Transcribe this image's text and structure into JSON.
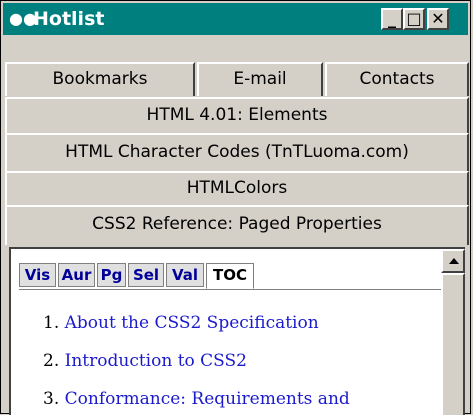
{
  "window": {
    "title": "Hotlist",
    "icon": "glasses-icon"
  },
  "title_buttons": {
    "minimize": "_",
    "maximize": "□",
    "close": "✕"
  },
  "tabs_row1": [
    "Bookmarks",
    "E-mail",
    "Contacts"
  ],
  "stacked_tabs": [
    "HTML 4.01: Elements",
    "HTML Character Codes (TnTLuoma.com)",
    "HTMLColors",
    "CSS2 Reference: Paged Properties"
  ],
  "sub_tabs": [
    "Vis",
    "Aur",
    "Pg",
    "Sel",
    "Val",
    "TOC"
  ],
  "active_sub_tab": "TOC",
  "toc": [
    {
      "num": "1.",
      "text": "About the CSS2 Specification"
    },
    {
      "num": "2.",
      "text": "Introduction to CSS2"
    },
    {
      "num": "3.",
      "text": "Conformance: Requirements and"
    }
  ],
  "colors": {
    "titlebar": "#007f7f",
    "link": "#1a1acc",
    "subtab_text": "#000099",
    "chrome": "#d4d0c8"
  }
}
